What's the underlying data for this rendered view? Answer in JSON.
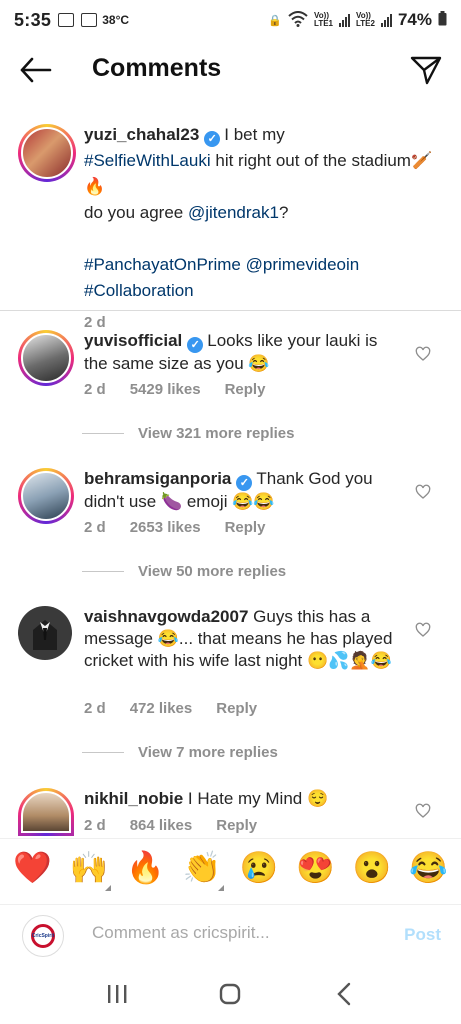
{
  "status_bar": {
    "time": "5:35",
    "temp": "38°C",
    "net1": "Vo))\nLTE1",
    "net2": "Vo))\nLTE2",
    "battery": "74%"
  },
  "header": {
    "title": "Comments"
  },
  "caption": {
    "username": "yuzi_chahal23",
    "text_pre": "I bet my",
    "hashtag1": "#SelfieWithLauki",
    "text_mid": "hit right out of the stadium🏏🔥",
    "line2_pre": "do you agree",
    "mention": "@jitendrak1",
    "line2_post": "?",
    "hashtag2": "#PanchayatOnPrime",
    "mention2": "@primevideoin",
    "hashtag3": "#Collaboration",
    "time": "2 d"
  },
  "comments": [
    {
      "username": "yuvisofficial",
      "verified": true,
      "text": "Looks like your lauki is the same size as you 😂",
      "time": "2 d",
      "likes": "5429 likes",
      "reply": "Reply",
      "view_replies": "View 321 more replies"
    },
    {
      "username": "behramsiganporia",
      "verified": true,
      "text": "Thank God you didn't use 🍆 emoji 😂😂",
      "time": "2 d",
      "likes": "2653 likes",
      "reply": "Reply",
      "view_replies": "View 50 more replies"
    },
    {
      "username": "vaishnavgowda2007",
      "verified": false,
      "text": "Guys this has a message 😂... that means he has played cricket with his wife last night 😶💦🤦😂",
      "time": "2 d",
      "likes": "472 likes",
      "reply": "Reply",
      "view_replies": "View 7 more replies"
    },
    {
      "username": "nikhil_nobie",
      "verified": false,
      "text": "I Hate my Mind 😌",
      "time": "2 d",
      "likes": "864 likes",
      "reply": "Reply"
    }
  ],
  "emoji_bar": [
    "❤️",
    "🙌",
    "🔥",
    "👏",
    "😢",
    "😍",
    "😮",
    "😂"
  ],
  "input": {
    "placeholder": "Comment as cricspirit...",
    "avatar_text": "CricSpirit",
    "post_label": "Post"
  }
}
